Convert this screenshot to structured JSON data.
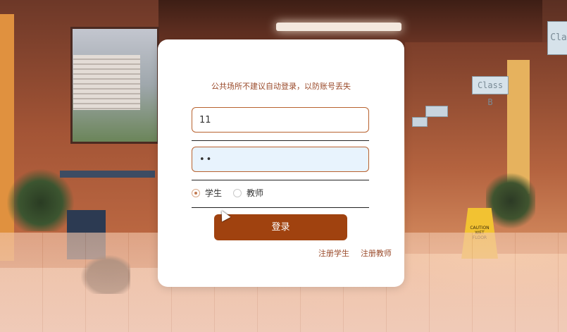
{
  "background": {
    "sign_class_b": "Class B",
    "sign_class_right": "Cla",
    "caution_text": "CAUTION WET FLOOR"
  },
  "login": {
    "notice": "公共场所不建议自动登录，以防账号丢失",
    "username_value": "11",
    "password_value": "••",
    "role_options": [
      "学生",
      "教师"
    ],
    "selected_role": "学生",
    "login_button": "登录",
    "register_student": "注册学生",
    "register_teacher": "注册教师"
  },
  "colors": {
    "accent": "#a0420f",
    "link": "#9a4a2a",
    "input_border": "#b8622f",
    "password_bg": "#e8f3fd"
  }
}
